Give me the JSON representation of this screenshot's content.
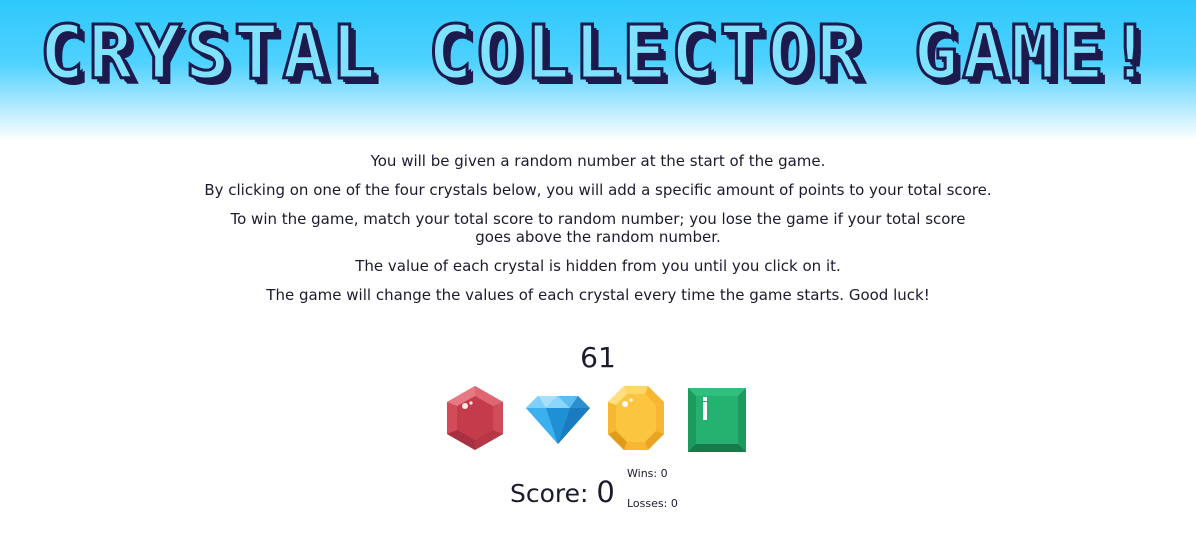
{
  "game": {
    "title": "CRYSTAL COLLECTOR GAME!",
    "instructions": [
      "You will be given a random number at the start of the game.",
      "By clicking on one of the four crystals below, you will add a specific amount of points to your total score.",
      "To win the game, match your total score to random number; you lose the game if your total score goes above the random number.",
      "The value of each crystal is hidden from you until you click on it.",
      "The game will change the values of each crystal every time the game starts. Good luck!"
    ],
    "target_number": "61",
    "crystals": [
      {
        "icon": "red-hexagon-crystal-icon",
        "color": "#d24b59"
      },
      {
        "icon": "blue-diamond-crystal-icon",
        "color": "#2fa3e6"
      },
      {
        "icon": "yellow-octagon-crystal-icon",
        "color": "#f7b733"
      },
      {
        "icon": "green-square-crystal-icon",
        "color": "#22a86a"
      }
    ],
    "score_label": "Score:",
    "score_value": "0",
    "wins_label": "Wins: 0",
    "losses_label": "Losses: 0"
  },
  "colors": {
    "header_top": "#2ec8fb",
    "title_fill": "#7fe3ff",
    "title_outline": "#1d1a4d",
    "text": "#1b1b2e"
  }
}
